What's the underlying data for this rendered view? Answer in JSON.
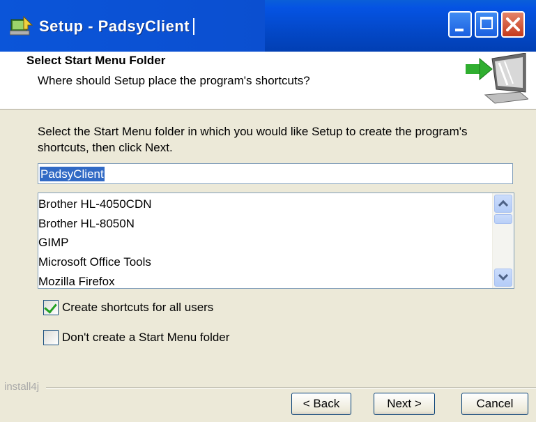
{
  "window": {
    "title": "Setup - PadsyClient",
    "controls": [
      "minimize",
      "maximize",
      "close"
    ]
  },
  "header": {
    "title": "Select Start Menu Folder",
    "subtitle": "Where should Setup place the program's shortcuts?"
  },
  "body": {
    "description": "Select the Start Menu folder in which you would like Setup to create the program's shortcuts, then click Next.",
    "folder_input_value": "PadsyClient",
    "folder_list": [
      "Brother HL-4050CDN",
      "Brother HL-8050N",
      "GIMP",
      "Microsoft Office Tools",
      "Mozilla Firefox"
    ]
  },
  "options": {
    "all_users_label": "Create shortcuts for all users",
    "all_users_checked": true,
    "no_folder_label": "Don't create a Start Menu folder",
    "no_folder_checked": false
  },
  "footer": {
    "vendor": "install4j",
    "back_label": "< Back",
    "next_label": "Next >",
    "cancel_label": "Cancel"
  }
}
